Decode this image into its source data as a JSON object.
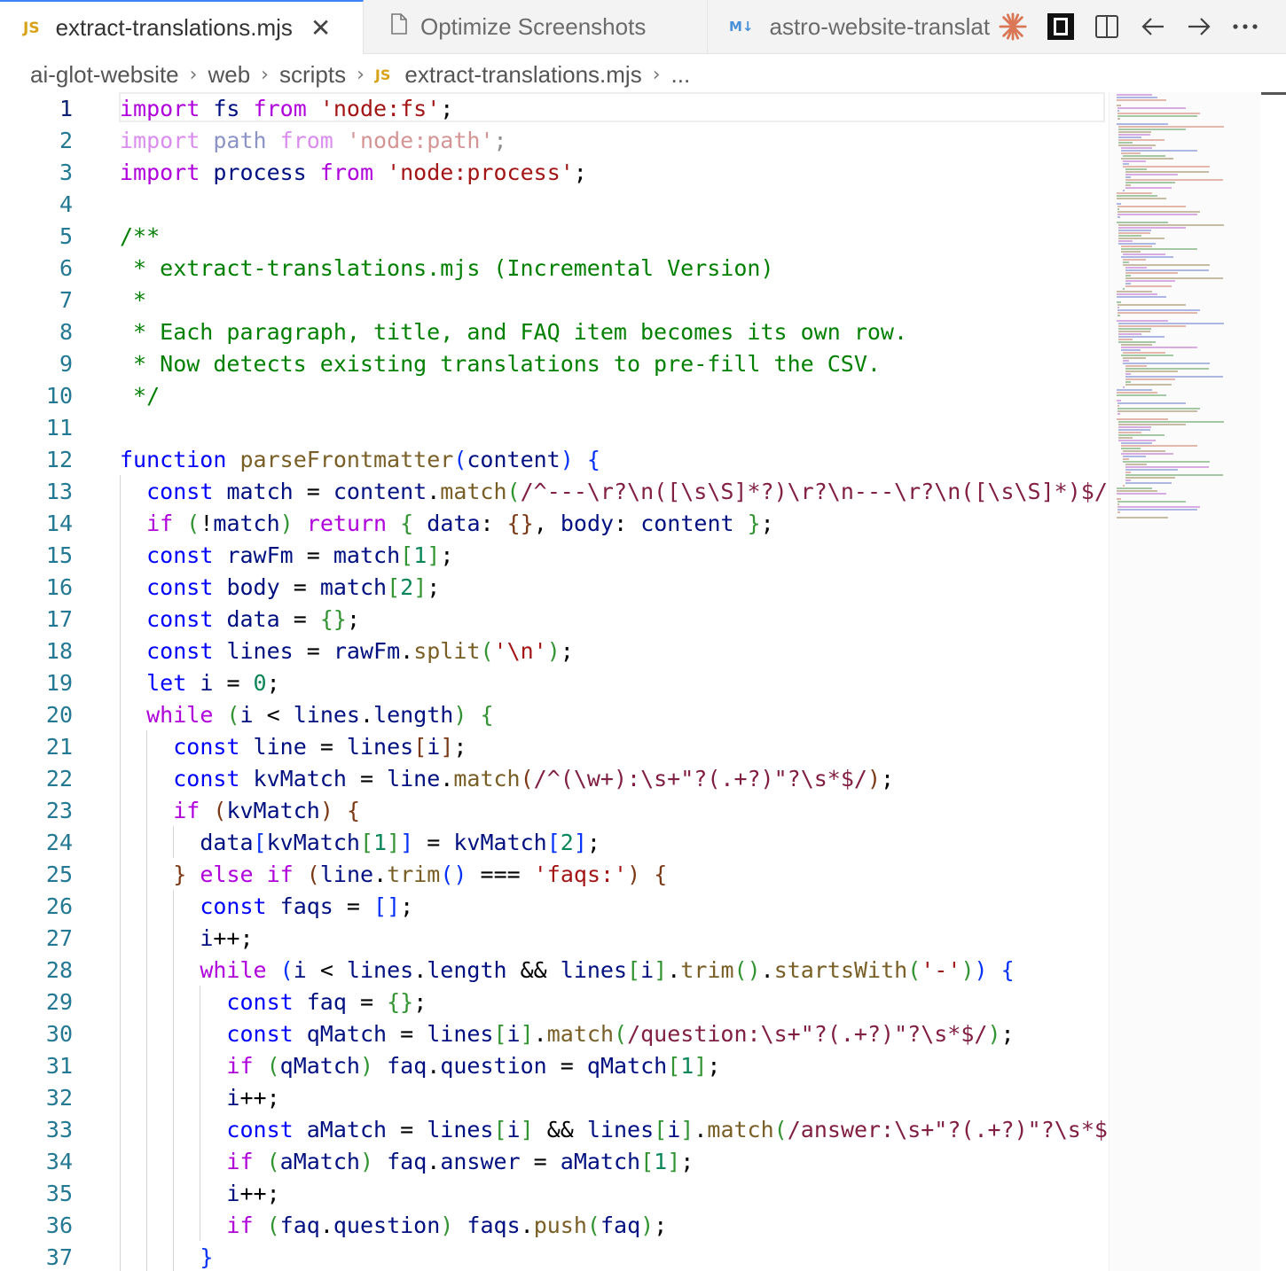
{
  "tabs": [
    {
      "icon": "JS",
      "label": "extract-translations.mjs",
      "close": "✕",
      "active": true
    },
    {
      "icon": "file",
      "label": "Optimize Screenshots",
      "active": false
    },
    {
      "icon": "M↓",
      "label": "astro-website-translat",
      "active": false
    }
  ],
  "tab_actions": [
    "claude-sparkle-icon",
    "preview-icon",
    "split-editor-icon",
    "back-icon",
    "forward-icon",
    "more-icon"
  ],
  "breadcrumb": {
    "items": [
      "ai-glot-website",
      "web",
      "scripts"
    ],
    "file_icon": "JS",
    "file": "extract-translations.mjs",
    "tail": "..."
  },
  "editor": {
    "current_line": 1,
    "line_numbers": [
      "1",
      "2",
      "3",
      "4",
      "5",
      "6",
      "7",
      "8",
      "9",
      "10",
      "11",
      "12",
      "13",
      "14",
      "15",
      "16",
      "17",
      "18",
      "19",
      "20",
      "21",
      "22",
      "23",
      "24",
      "25",
      "26",
      "27",
      "28",
      "29",
      "30",
      "31",
      "32",
      "33",
      "34",
      "35",
      "36",
      "37"
    ],
    "lines": [
      "import fs from 'node:fs';",
      "import path from 'node:path';",
      "import process from 'node:process';",
      "",
      "/**",
      " * extract-translations.mjs (Incremental Version)",
      " *",
      " * Each paragraph, title, and FAQ item becomes its own row.",
      " * Now detects existing translations to pre-fill the CSV.",
      " */",
      "",
      "function parseFrontmatter(content) {",
      "  const match = content.match(/^---\\r?\\n([\\s\\S]*?)\\r?\\n---\\r?\\n([\\s\\S]*)$/);",
      "  if (!match) return { data: {}, body: content };",
      "  const rawFm = match[1];",
      "  const body = match[2];",
      "  const data = {};",
      "  const lines = rawFm.split('\\n');",
      "  let i = 0;",
      "  while (i < lines.length) {",
      "    const line = lines[i];",
      "    const kvMatch = line.match(/^(\\w+):\\s+\"?(.+?)\"?\\s*$/);",
      "    if (kvMatch) {",
      "      data[kvMatch[1]] = kvMatch[2];",
      "    } else if (line.trim() === 'faqs:') {",
      "      const faqs = [];",
      "      i++;",
      "      while (i < lines.length && lines[i].trim().startsWith('-')) {",
      "        const faq = {};",
      "        const qMatch = lines[i].match(/question:\\s+\"?(.+?)\"?\\s*$/);",
      "        if (qMatch) faq.question = qMatch[1];",
      "        i++;",
      "        const aMatch = lines[i] && lines[i].match(/answer:\\s+\"?(.+?)\"?\\s*$/);",
      "        if (aMatch) faq.answer = aMatch[1];",
      "        i++;",
      "        if (faq.question) faqs.push(faq);",
      "      }"
    ]
  }
}
